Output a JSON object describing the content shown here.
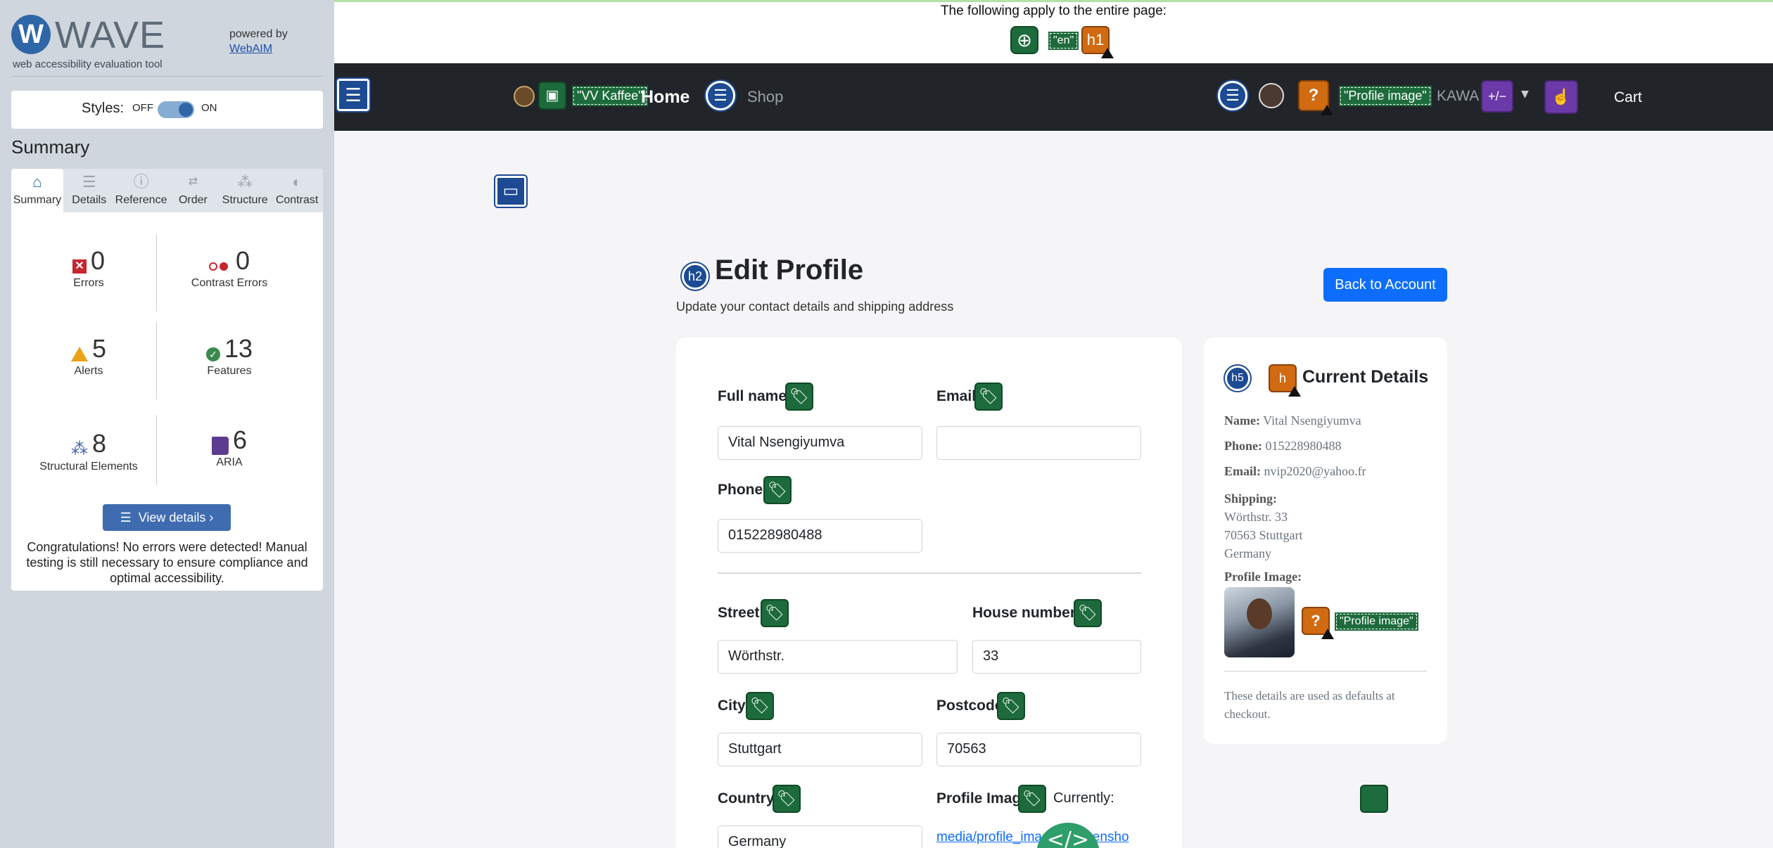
{
  "wave": {
    "logo_letter": "W",
    "logo_text": "WAVE",
    "tagline": "web accessibility evaluation tool",
    "powered_by": "powered by",
    "powered_link": "WebAIM",
    "styles": {
      "label": "Styles:",
      "off": "OFF",
      "on": "ON"
    },
    "summary_heading": "Summary",
    "tabs": [
      {
        "label": "Summary",
        "icon": "home-icon"
      },
      {
        "label": "Details",
        "icon": "list-icon"
      },
      {
        "label": "Reference",
        "icon": "info-icon"
      },
      {
        "label": "Order",
        "icon": "order-icon"
      },
      {
        "label": "Structure",
        "icon": "structure-icon"
      },
      {
        "label": "Contrast",
        "icon": "contrast-icon"
      }
    ],
    "stats": {
      "errors": {
        "value": "0",
        "label": "Errors"
      },
      "contrast": {
        "value": "0",
        "label": "Contrast Errors"
      },
      "alerts": {
        "value": "5",
        "label": "Alerts"
      },
      "features": {
        "value": "13",
        "label": "Features"
      },
      "structural": {
        "value": "8",
        "label": "Structural Elements"
      },
      "aria": {
        "value": "6",
        "label": "ARIA"
      }
    },
    "view_details": "View details ›",
    "congrats": "Congratulations! No errors were detected! Manual testing is still necessary to ensure compliance and optimal accessibility.",
    "colors": {
      "sidebar": "#d0d6de",
      "accent": "#2f66a8",
      "error": "#c6262e",
      "alert": "#e8a317",
      "feature": "#3a8a4b",
      "aria": "#5c3c8e"
    }
  },
  "page": {
    "apply_text": "The following apply to the entire page:",
    "lang_tag": "\"en\"",
    "h1_icon_text": "h1",
    "nav": {
      "brand_tag": "\"VV Kaffee\"",
      "home": "Home",
      "shop": "Shop",
      "profile_tag": "\"Profile image\"",
      "user": "KAWA",
      "aria_icon_text": "+/−",
      "cart": "Cart"
    },
    "h2_icon_text": "h2",
    "title": "Edit Profile",
    "subtitle": "Update your contact details and shipping address",
    "back_button": "Back to Account",
    "form": {
      "full_name": {
        "label": "Full name",
        "value": "Vital Nsengiyumva"
      },
      "email": {
        "label": "Email",
        "value": ""
      },
      "phone": {
        "label": "Phone",
        "value": "015228980488"
      },
      "street": {
        "label": "Street",
        "value": "Wörthstr."
      },
      "house_number": {
        "label": "House number",
        "value": "33"
      },
      "city": {
        "label": "City",
        "value": "Stuttgart"
      },
      "postcode": {
        "label": "Postcode",
        "value": "70563"
      },
      "country": {
        "label": "Country",
        "value": "Germany"
      },
      "profile_image": {
        "label": "Profile Image",
        "currently": "Currently:",
        "link": "media/profile_images/screensho"
      }
    },
    "details": {
      "h5_icon_text": "h5",
      "h_icon_text": "h",
      "heading": "Current Details",
      "name_label": "Name:",
      "name": "Vital Nsengiyumva",
      "phone_label": "Phone:",
      "phone": "015228980488",
      "email_label": "Email:",
      "email": "nvip2020@yahoo.fr",
      "shipping_label": "Shipping:",
      "shipping_line1": "Wörthstr. 33",
      "shipping_line2": "70563 Stuttgart",
      "shipping_line3": "Germany",
      "image_label": "Profile Image:",
      "image_tag": "\"Profile image\"",
      "note": "These details are used as defaults at checkout."
    }
  }
}
